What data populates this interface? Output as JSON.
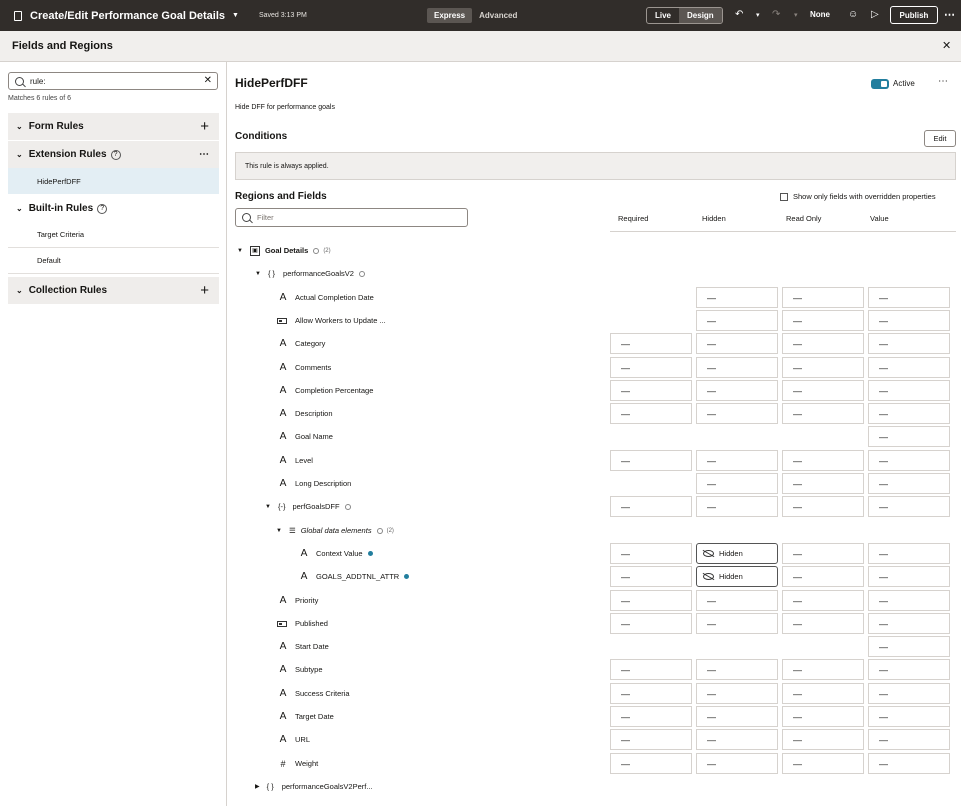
{
  "topbar": {
    "title": "Create/Edit Performance Goal Details",
    "saved": "Saved 3:13 PM",
    "mode_express": "Express",
    "mode_advanced": "Advanced",
    "live": "Live",
    "design": "Design",
    "none_label": "None",
    "publish": "Publish"
  },
  "panel": {
    "title": "Fields and Regions"
  },
  "left": {
    "search_value": "rule:",
    "matches": "Matches 6 rules of 6",
    "form_rules": "Form Rules",
    "extension_rules": "Extension Rules",
    "extension_items": [
      "HidePerfDFF"
    ],
    "builtin_rules": "Built-in Rules",
    "builtin_items": [
      "Target Criteria",
      "Default"
    ],
    "collection_rules": "Collection Rules"
  },
  "rule": {
    "name": "HidePerfDFF",
    "description": "Hide DFF for performance goals",
    "status": "Active",
    "conditions_title": "Conditions",
    "edit": "Edit",
    "condition_text": "This rule is always applied.",
    "regions_title": "Regions and Fields",
    "show_only": "Show only fields with overridden properties",
    "filter_placeholder": "Filter",
    "columns": {
      "required": "Required",
      "hidden": "Hidden",
      "read_only": "Read Only",
      "value": "Value"
    }
  },
  "tree": {
    "goal_details": "Goal Details",
    "goal_details_count": "(2)",
    "performance_goals": "performanceGoalsV2",
    "perf_goals_dff": "perfGoalsDFF",
    "global_data": "Global data elements",
    "global_data_count": "(2)",
    "performance_goals_perf": "performanceGoalsV2Perf...",
    "dash": "—",
    "hidden_label": "Hidden",
    "fields": [
      {
        "name": "Actual Completion Date",
        "icon": "text",
        "cols": [
          false,
          true,
          true,
          true
        ]
      },
      {
        "name": "Allow Workers to Update ...",
        "icon": "boolean",
        "cols": [
          false,
          true,
          true,
          true
        ]
      },
      {
        "name": "Category",
        "icon": "text",
        "cols": [
          true,
          true,
          true,
          true
        ]
      },
      {
        "name": "Comments",
        "icon": "text",
        "cols": [
          true,
          true,
          true,
          true
        ]
      },
      {
        "name": "Completion Percentage",
        "icon": "text",
        "cols": [
          true,
          true,
          true,
          true
        ]
      },
      {
        "name": "Description",
        "icon": "text",
        "cols": [
          true,
          true,
          true,
          true
        ]
      },
      {
        "name": "Goal Name",
        "icon": "text",
        "cols": [
          false,
          false,
          false,
          true
        ]
      },
      {
        "name": "Level",
        "icon": "text",
        "cols": [
          true,
          true,
          true,
          true
        ]
      },
      {
        "name": "Long Description",
        "icon": "text",
        "cols": [
          false,
          true,
          true,
          true
        ]
      }
    ],
    "dff_fields": [
      {
        "name": "Context Value"
      },
      {
        "name": "GOALS_ADDTNL_ATTR"
      }
    ],
    "fields2": [
      {
        "name": "Priority",
        "icon": "text"
      },
      {
        "name": "Published",
        "icon": "boolean"
      },
      {
        "name": "Start Date",
        "icon": "text"
      },
      {
        "name": "Subtype",
        "icon": "text"
      },
      {
        "name": "Success Criteria",
        "icon": "text"
      },
      {
        "name": "Target Date",
        "icon": "text"
      },
      {
        "name": "URL",
        "icon": "text"
      },
      {
        "name": "Weight",
        "icon": "number"
      }
    ]
  }
}
